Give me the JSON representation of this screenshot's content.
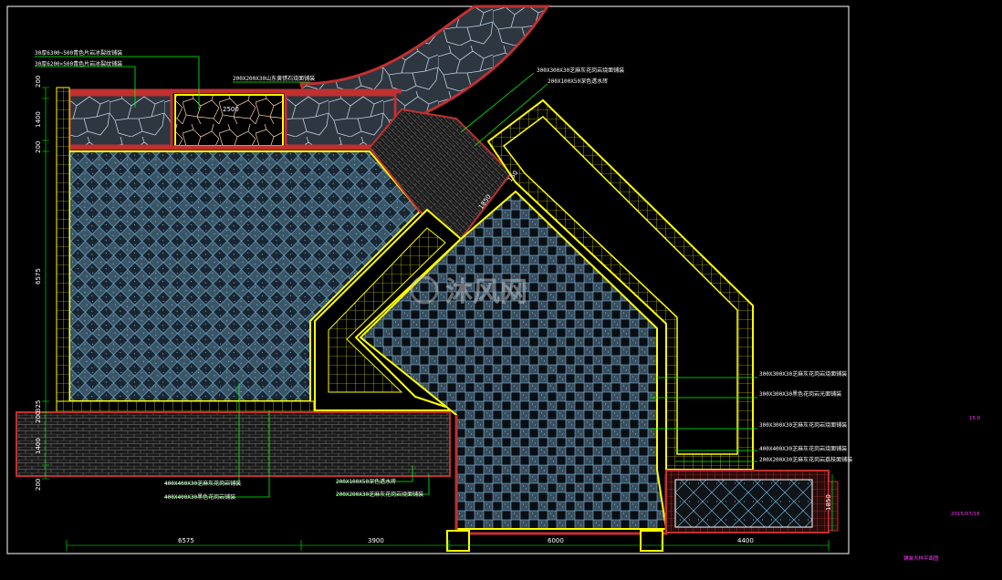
{
  "drawing": {
    "title": "铺装大样平面图",
    "date": "2015/07/16",
    "sheet_code": "15.0",
    "watermark": "沐风网"
  },
  "dimensions": {
    "bottom": [
      "6575",
      "3900",
      "6000",
      "4400"
    ],
    "left": [
      "200",
      "1400",
      "200",
      "6575",
      "325",
      "200",
      "1400",
      "200"
    ],
    "inner_2500": "2500",
    "diag_1": "1850",
    "diag_2": "150",
    "right_small": "1850"
  },
  "callouts": {
    "top_left_1": "30厚6300~500青色片岩冰裂纹铺装",
    "top_left_2": "30厚6200×500青色片岩冰裂纹铺装",
    "top_mid": "200X200X30山东黄锈石烧面铺装",
    "top_right_1": "300X300X30芝麻灰花岗岩烧面铺装",
    "top_right_2": "200X100X50深色透水砖",
    "right_1": "300X300X30芝麻灰花岗岩烧面铺装",
    "right_2": "300X300X30黑色花岗岩光面铺装",
    "right_3": "300X300X30芝麻灰花岗岩烧面铺装",
    "right_4": "400X400X30芝麻灰花岗岩烧面铺装",
    "right_5": "200X200X30芝麻灰花岗岩荔枝面铺装",
    "bottom_left_1": "400X400X30芝麻灰花岗岩铺装",
    "bottom_left_2": "400X400X30黑色花岗岩铺装",
    "bottom_mid_1": "200X100X50深色透水砖",
    "bottom_mid_2": "200X200X30芝麻灰花岗岩烧面铺装"
  },
  "colors": {
    "outline": "#ffff00",
    "brick": "#c03030",
    "tile": "#7fd3ff",
    "leader": "#00ff00",
    "magenta": "#ff33ff",
    "frame": "#ffffff"
  }
}
